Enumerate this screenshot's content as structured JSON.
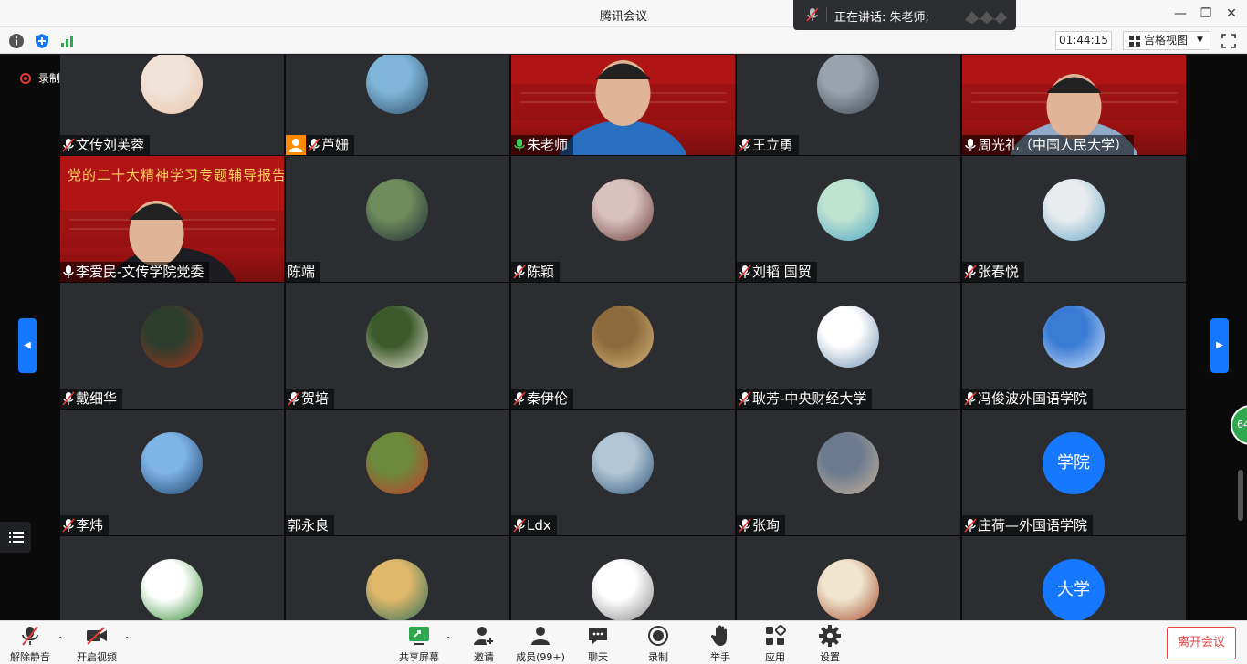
{
  "window": {
    "title": "腾讯会议"
  },
  "toolbar": {
    "timer": "01:44:15",
    "view_label": "宫格视图"
  },
  "speaking": {
    "text": "正在讲话: 朱老师;"
  },
  "recording": {
    "label": "录制中"
  },
  "participants": [
    {
      "name": "文传刘芙蓉"
    },
    {
      "name": "芦姗"
    },
    {
      "name": "朱老师"
    },
    {
      "name": "王立勇"
    },
    {
      "name": "周光礼（中国人民大学）"
    },
    {
      "name": "李爱民-文传学院党委"
    },
    {
      "name": "陈端"
    },
    {
      "name": "陈颖"
    },
    {
      "name": "刘韬 国贸"
    },
    {
      "name": "张春悦"
    },
    {
      "name": "戴细华"
    },
    {
      "name": "贺培"
    },
    {
      "name": "秦伊伦"
    },
    {
      "name": "耿芳-中央财经大学"
    },
    {
      "name": "冯俊波外国语学院"
    },
    {
      "name": "李炜"
    },
    {
      "name": "郭永良"
    },
    {
      "name": "Ldx"
    },
    {
      "name": "张珣"
    },
    {
      "name": "庄荷—外国语学院"
    },
    {
      "name": ""
    },
    {
      "name": ""
    },
    {
      "name": ""
    },
    {
      "name": ""
    },
    {
      "name": ""
    }
  ],
  "avatar_text": {
    "t19": "学院",
    "t24": "大学"
  },
  "banner": {
    "title": "党的二十大精神学习专题辅导报告会"
  },
  "pager": {
    "count": "64"
  },
  "bottom": {
    "unmute": "解除静音",
    "video": "开启视频",
    "share": "共享屏幕",
    "invite": "邀请",
    "members": "成员(99+)",
    "chat": "聊天",
    "record": "录制",
    "raise_hand": "举手",
    "apps": "应用",
    "settings": "设置",
    "leave": "离开会议"
  },
  "colors": {
    "accent": "#1677ff",
    "danger": "#e54545",
    "tile_bg": "#2c2d30",
    "banner_red": "#b01414"
  }
}
